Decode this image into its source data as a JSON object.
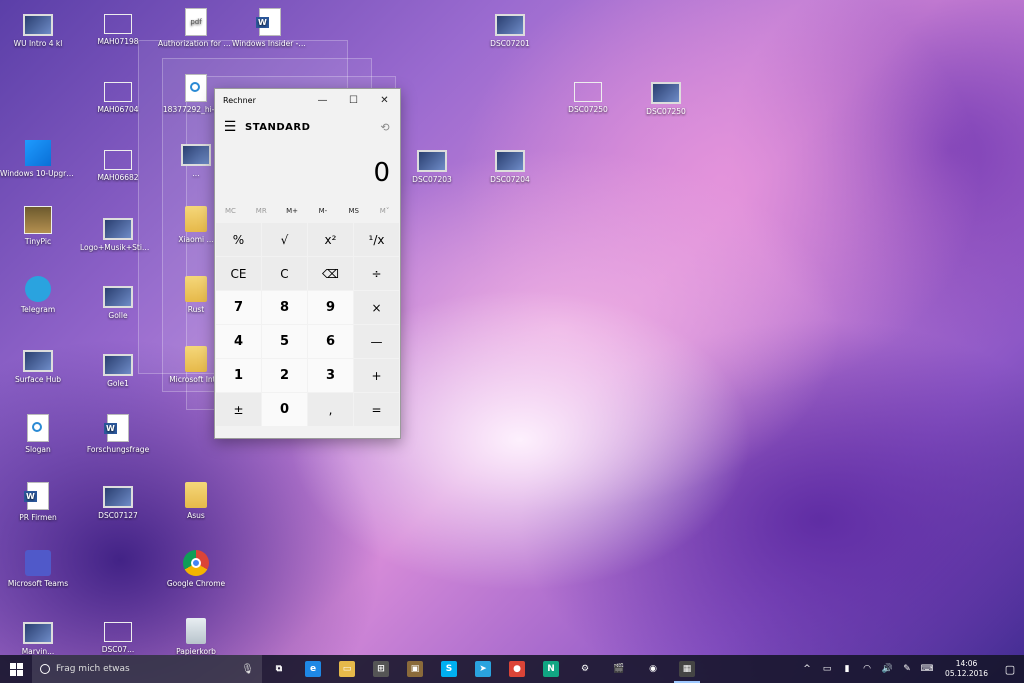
{
  "desktop": {
    "icons": [
      {
        "label": "WU Intro 4 kl",
        "kind": "screen"
      },
      {
        "label": "MAH07198",
        "kind": "photo"
      },
      {
        "label": "Authorization for Usage of our A...",
        "kind": "pdf"
      },
      {
        "label": "Windows Insider - Diagramm",
        "kind": "word"
      },
      {
        "label": "DSC07201",
        "kind": "screen"
      },
      {
        "label": "MAH06704",
        "kind": "photo"
      },
      {
        "label": "18377292_hi-te...",
        "kind": "slogan"
      },
      {
        "label": "DSC07250",
        "kind": "photo"
      },
      {
        "label": "DSC07250",
        "kind": "screen"
      },
      {
        "label": "Windows 10-Upgrade-Assist...",
        "kind": "win"
      },
      {
        "label": "MAH06682",
        "kind": "photo"
      },
      {
        "label": "DSC07203",
        "kind": "screen"
      },
      {
        "label": "DSC07204",
        "kind": "screen"
      },
      {
        "label": "TinyPic",
        "kind": "mona"
      },
      {
        "label": "Logo+Musik+Stim...",
        "kind": "screen"
      },
      {
        "label": "Telegram",
        "kind": "tg"
      },
      {
        "label": "Golle",
        "kind": "screen"
      },
      {
        "label": "Surface Hub",
        "kind": "screen"
      },
      {
        "label": "Gole1",
        "kind": "screen"
      },
      {
        "label": "Microsoft Int...",
        "kind": "folder"
      },
      {
        "label": "Slogan",
        "kind": "slogan"
      },
      {
        "label": "Forschungsfrage",
        "kind": "word"
      },
      {
        "label": "PR Firmen",
        "kind": "word"
      },
      {
        "label": "DSC07127",
        "kind": "screen"
      },
      {
        "label": "Asus",
        "kind": "folder"
      },
      {
        "label": "Microsoft Teams",
        "kind": "teams"
      },
      {
        "label": "Google Chrome",
        "kind": "chrome"
      },
      {
        "label": "Marvin...",
        "kind": "screen"
      },
      {
        "label": "DSC07...",
        "kind": "photo"
      },
      {
        "label": "Papierkorb",
        "kind": "bin"
      },
      {
        "label": "Xiaomi ...",
        "kind": "folder"
      },
      {
        "label": "Rust",
        "kind": "folder"
      },
      {
        "label": "...",
        "kind": "screen"
      }
    ]
  },
  "calculator": {
    "title": "Rechner",
    "mode": "STANDARD",
    "display": "0",
    "window_buttons": {
      "minimize": "—",
      "maximize": "☐",
      "close": "✕"
    },
    "menu_icon": "☰",
    "history_icon": "⟲",
    "memory": [
      {
        "label": "MC",
        "enabled": false
      },
      {
        "label": "MR",
        "enabled": false
      },
      {
        "label": "M+",
        "enabled": true
      },
      {
        "label": "M-",
        "enabled": true
      },
      {
        "label": "MS",
        "enabled": true
      },
      {
        "label": "M˅",
        "enabled": false
      }
    ],
    "keys": [
      {
        "label": "%",
        "type": "op",
        "name": "percent-key"
      },
      {
        "label": "√",
        "type": "op",
        "name": "sqrt-key"
      },
      {
        "label": "x²",
        "type": "op",
        "name": "square-key"
      },
      {
        "label": "¹/x",
        "type": "op",
        "name": "reciprocal-key"
      },
      {
        "label": "CE",
        "type": "op",
        "name": "clear-entry-key"
      },
      {
        "label": "C",
        "type": "op",
        "name": "clear-key"
      },
      {
        "label": "⌫",
        "type": "op",
        "name": "backspace-key"
      },
      {
        "label": "÷",
        "type": "op",
        "name": "divide-key"
      },
      {
        "label": "7",
        "type": "num",
        "name": "digit-7-key"
      },
      {
        "label": "8",
        "type": "num",
        "name": "digit-8-key"
      },
      {
        "label": "9",
        "type": "num",
        "name": "digit-9-key"
      },
      {
        "label": "×",
        "type": "op",
        "name": "multiply-key"
      },
      {
        "label": "4",
        "type": "num",
        "name": "digit-4-key"
      },
      {
        "label": "5",
        "type": "num",
        "name": "digit-5-key"
      },
      {
        "label": "6",
        "type": "num",
        "name": "digit-6-key"
      },
      {
        "label": "—",
        "type": "op",
        "name": "subtract-key"
      },
      {
        "label": "1",
        "type": "num",
        "name": "digit-1-key"
      },
      {
        "label": "2",
        "type": "num",
        "name": "digit-2-key"
      },
      {
        "label": "3",
        "type": "num",
        "name": "digit-3-key"
      },
      {
        "label": "+",
        "type": "op",
        "name": "add-key"
      },
      {
        "label": "±",
        "type": "op",
        "name": "negate-key"
      },
      {
        "label": "0",
        "type": "num",
        "name": "digit-0-key"
      },
      {
        "label": ",",
        "type": "op",
        "name": "decimal-key"
      },
      {
        "label": "=",
        "type": "op",
        "name": "equals-key"
      }
    ]
  },
  "taskbar": {
    "search_placeholder": "Frag mich etwas",
    "apps": [
      {
        "name": "task-view",
        "glyph": "⧉",
        "color": "transparent"
      },
      {
        "name": "edge",
        "glyph": "e",
        "color": "#1e88e5"
      },
      {
        "name": "file-explorer",
        "glyph": "▭",
        "color": "#e6b94a"
      },
      {
        "name": "store",
        "glyph": "⊞",
        "color": "#555555"
      },
      {
        "name": "photo-app",
        "glyph": "▣",
        "color": "#8a6a3a"
      },
      {
        "name": "skype",
        "glyph": "S",
        "color": "#00aff0"
      },
      {
        "name": "telegram",
        "glyph": "➤",
        "color": "#2aa3df"
      },
      {
        "name": "chrome",
        "glyph": "●",
        "color": "#db4437"
      },
      {
        "name": "n-app",
        "glyph": "N",
        "color": "#11a683"
      },
      {
        "name": "settings",
        "glyph": "⚙",
        "color": "transparent"
      },
      {
        "name": "movies",
        "glyph": "🎬",
        "color": "transparent"
      },
      {
        "name": "camera",
        "glyph": "◉",
        "color": "transparent"
      },
      {
        "name": "calculator",
        "glyph": "▦",
        "color": "#444444"
      }
    ],
    "tray": [
      "^",
      "▭",
      "▮",
      "◠",
      "🔊",
      "✎",
      "⌨"
    ],
    "time": "14:06",
    "date": "05.12.2016",
    "notification_glyph": "▢"
  }
}
